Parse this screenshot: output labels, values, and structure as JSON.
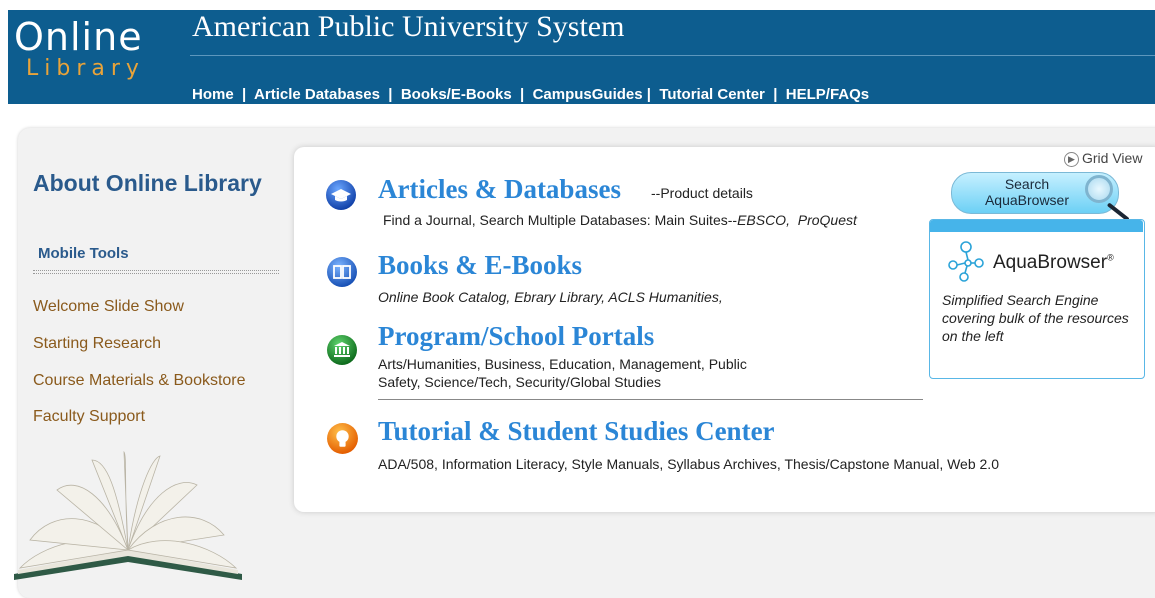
{
  "header": {
    "logo_top": "Online",
    "logo_bottom": "Library",
    "site_title": "American Public University System",
    "nav": [
      {
        "label": "Home"
      },
      {
        "label": "Article Databases"
      },
      {
        "label": "Books/E-Books"
      },
      {
        "label": "CampusGuides"
      },
      {
        "label": "Tutorial Center"
      },
      {
        "label": "HELP/FAQs"
      }
    ]
  },
  "sidebar": {
    "title": "About Online Library",
    "mobile_tools": "Mobile Tools",
    "links": [
      {
        "label": "Welcome Slide Show"
      },
      {
        "label": "Starting Research"
      },
      {
        "label": "Course Materials & Bookstore"
      },
      {
        "label": "Faculty Support"
      }
    ]
  },
  "main": {
    "grid_view": "Grid View",
    "sections": [
      {
        "title": "Articles & Databases",
        "suffix": "--Product details",
        "desc_plain": "Find a Journal, Search Multiple Databases: Main Suites--",
        "desc_italic_1": "EBSCO,",
        "desc_italic_2": "ProQuest",
        "icon": "mortarboard-icon",
        "icon_color": "#1f5fbf"
      },
      {
        "title": "Books & E-Books",
        "desc": "Online Book Catalog, Ebrary Library, ACLS Humanities,",
        "icon": "book-icon",
        "icon_color": "#2a6fd1"
      },
      {
        "title": "Program/School Portals",
        "desc_line1": "Arts/Humanities, Business, Education, Management,  Public",
        "desc_line2": "Safety,  Science/Tech, Security/Global Studies",
        "icon": "building-icon",
        "icon_color": "#1b8a2a"
      },
      {
        "title": "Tutorial & Student Studies Center",
        "desc": "ADA/508, Information Literacy, Style Manuals, Syllabus Archives, Thesis/Capstone Manual, Web 2.0",
        "icon": "lightbulb-icon",
        "icon_color": "#f07a0c"
      }
    ],
    "search_button": {
      "line1": "Search",
      "line2": "AquaBrowser"
    },
    "aquabrowser": {
      "name": "AquaBrowser",
      "trademark": "®",
      "desc": "Simplified Search Engine covering bulk of the resources on the left"
    }
  }
}
